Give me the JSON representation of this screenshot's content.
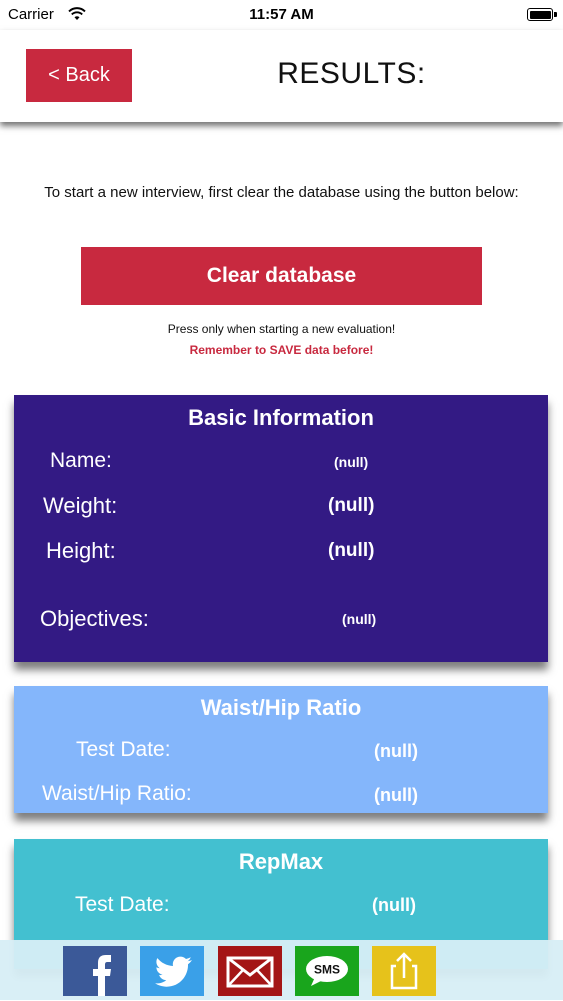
{
  "status_bar": {
    "carrier": "Carrier",
    "time": "11:57 AM"
  },
  "header": {
    "back_label": "< Back",
    "title": "RESULTS:"
  },
  "intro": {
    "text": "To start a new interview, first clear the database using the button below:",
    "clear_button": "Clear database",
    "note": "Press only when starting a new evaluation!",
    "warning": "Remember to SAVE data before!"
  },
  "basic_info": {
    "title": "Basic Information",
    "name_label": "Name:",
    "name_value": "(null)",
    "weight_label": "Weight:",
    "weight_value": "(null)",
    "height_label": "Height:",
    "height_value": "(null)",
    "objectives_label": "Objectives:",
    "objectives_value": "(null)"
  },
  "waist_hip": {
    "title": "Waist/Hip Ratio",
    "test_date_label": "Test Date:",
    "test_date_value": "(null)",
    "ratio_label": "Waist/Hip Ratio:",
    "ratio_value": "(null)"
  },
  "repmax": {
    "title": "RepMax",
    "test_date_label": "Test Date:",
    "test_date_value": "(null)"
  },
  "share_bar": {
    "icons": [
      "facebook-icon",
      "twitter-icon",
      "email-icon",
      "sms-icon",
      "share-icon"
    ],
    "sms_text": "SMS",
    "colors": {
      "facebook": "#3b5998",
      "twitter": "#3aa0e8",
      "email": "#a41616",
      "sms": "#19a51c",
      "share": "#e6c21b"
    }
  },
  "colors": {
    "accent_red": "#c8293f",
    "basic_bg": "#331a84",
    "waist_bg": "#84b6fb",
    "repmax_bg": "#43c0d0"
  }
}
